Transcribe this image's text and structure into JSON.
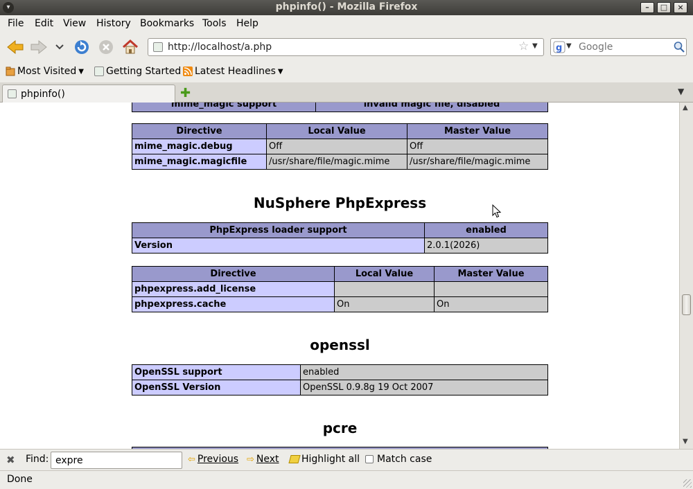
{
  "window": {
    "title": "phpinfo() - Mozilla Firefox"
  },
  "menu": {
    "file": "File",
    "edit": "Edit",
    "view": "View",
    "history": "History",
    "bookmarks": "Bookmarks",
    "tools": "Tools",
    "help": "Help"
  },
  "nav": {
    "url": "http://localhost/a.php",
    "search_placeholder": "Google"
  },
  "bookmarks": {
    "most_visited": "Most Visited",
    "getting_started": "Getting Started",
    "latest_headlines": "Latest Headlines"
  },
  "tabs": [
    {
      "label": "phpinfo()"
    }
  ],
  "content": {
    "partial_row": {
      "key": "mime_magic support",
      "value": "invalid magic file, disabled"
    },
    "mime_directives": {
      "headers": [
        "Directive",
        "Local Value",
        "Master Value"
      ],
      "rows": [
        {
          "name": "mime_magic.debug",
          "local": "Off",
          "master": "Off"
        },
        {
          "name": "mime_magic.magicfile",
          "local": "/usr/share/file/magic.mime",
          "master": "/usr/share/file/magic.mime"
        }
      ]
    },
    "nusphere": {
      "heading": "NuSphere PhpExpress",
      "info_headers": [
        "PhpExpress loader support",
        "enabled"
      ],
      "version_key": "Version",
      "version_value": "2.0.1(2026)",
      "directive_headers": [
        "Directive",
        "Local Value",
        "Master Value"
      ],
      "rows": [
        {
          "name": "phpexpress.add_license",
          "local": "",
          "master": ""
        },
        {
          "name": "phpexpress.cache",
          "local": "On",
          "master": "On"
        }
      ]
    },
    "openssl": {
      "heading": "openssl",
      "rows": [
        {
          "key": "OpenSSL support",
          "value": "enabled"
        },
        {
          "key": "OpenSSL Version",
          "value": "OpenSSL 0.9.8g 19 Oct 2007"
        }
      ]
    },
    "pcre": {
      "heading": "pcre"
    }
  },
  "findbar": {
    "label": "Find:",
    "value": "expre",
    "previous": "Previous",
    "next": "Next",
    "highlight_all": "Highlight all",
    "match_case": "Match case"
  },
  "status": {
    "text": "Done"
  }
}
